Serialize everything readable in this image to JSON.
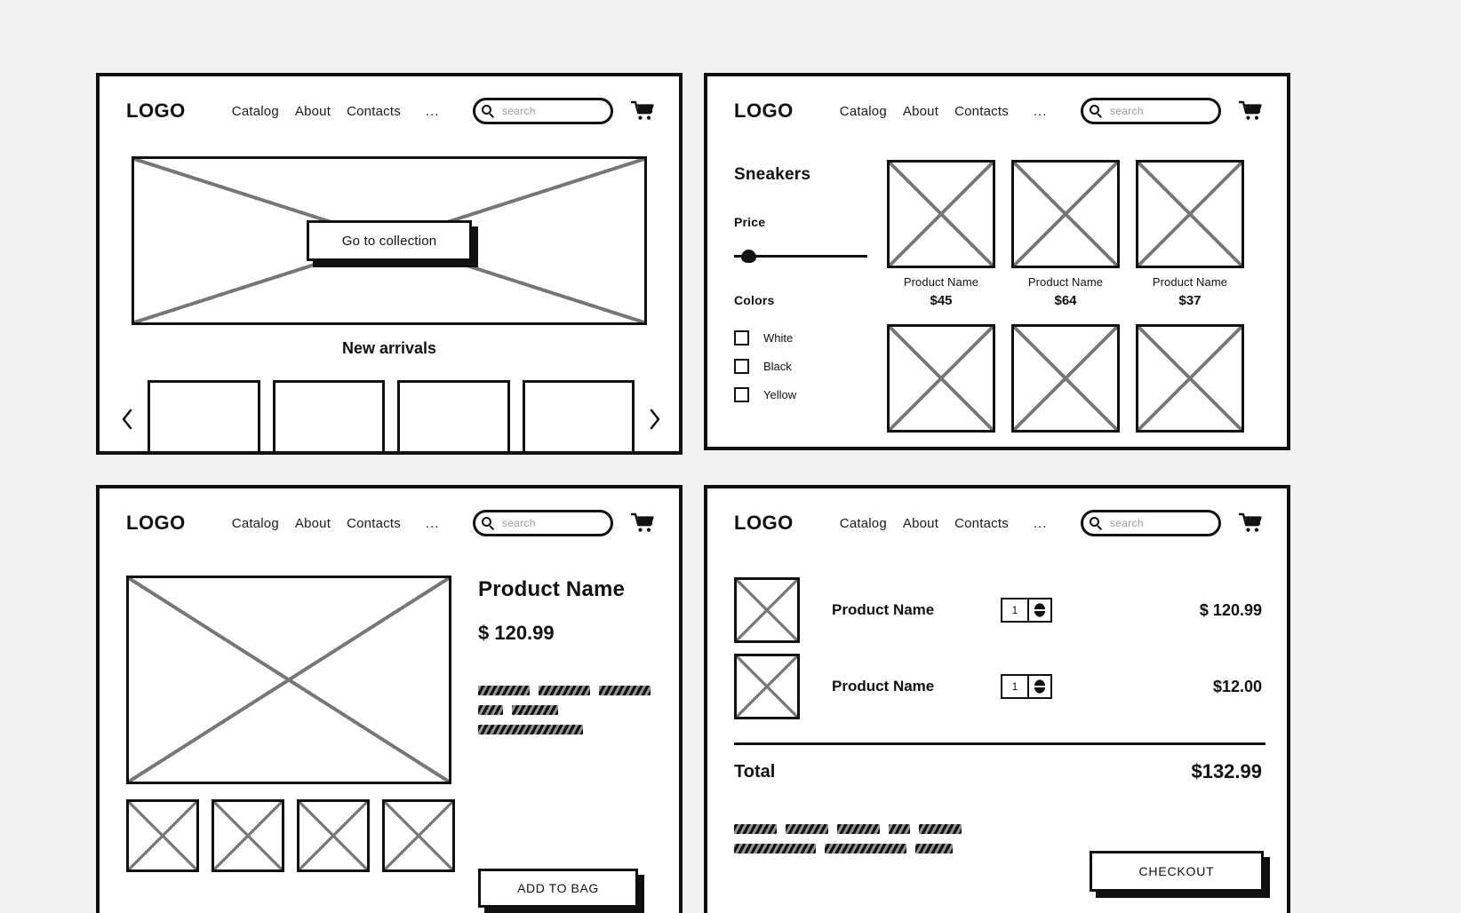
{
  "theme": {
    "background": "#f2f2f2",
    "panel_background": "#ffffff",
    "ink": "#111111",
    "placeholder_cross": "#777777",
    "placeholder_text": "#9a9a9a"
  },
  "nav": {
    "logo": "LOGO",
    "items": [
      "Catalog",
      "About",
      "Contacts"
    ],
    "more": "...",
    "search_placeholder": "search",
    "search_value": "",
    "search_icon": "search-icon",
    "cart_icon": "shopping-cart-icon"
  },
  "home": {
    "hero_image_alt": "hero-image-placeholder",
    "hero_cta": "Go to collection",
    "section_title": "New arrivals",
    "prev_label": "‹",
    "next_label": "›",
    "carousel_cards": [
      "",
      "",
      "",
      ""
    ]
  },
  "catalog": {
    "category_title": "Sneakers",
    "price_label": "Price",
    "price_slider_position_pct": 5,
    "colors_label": "Colors",
    "colors": [
      {
        "label": "White",
        "checked": false
      },
      {
        "label": "Black",
        "checked": false
      },
      {
        "label": "Yellow",
        "checked": false
      }
    ],
    "products": [
      {
        "name": "Product Name",
        "price": "$45"
      },
      {
        "name": "Product Name",
        "price": "$64"
      },
      {
        "name": "Product Name",
        "price": "$37"
      },
      {
        "name": "",
        "price": ""
      },
      {
        "name": "",
        "price": ""
      },
      {
        "name": "",
        "price": ""
      }
    ]
  },
  "product": {
    "name": "Product Name",
    "price": "$ 120.99",
    "main_image_alt": "product-main-image-placeholder",
    "thumbnails": [
      "",
      "",
      "",
      ""
    ],
    "description_lines": [
      [
        58,
        58,
        58
      ],
      [
        28,
        52
      ],
      [
        118
      ]
    ],
    "add_to_bag": "ADD TO BAG"
  },
  "cart": {
    "items": [
      {
        "name": "Product Name",
        "qty": "1",
        "price": "$ 120.99"
      },
      {
        "name": "Product Name",
        "qty": "1",
        "price": "$12.00"
      }
    ],
    "total_label": "Total",
    "total_value": "$132.99",
    "note_lines": [
      [
        48,
        48,
        48,
        24,
        48
      ],
      [
        92,
        92,
        42
      ]
    ],
    "checkout": "CHECKOUT"
  }
}
